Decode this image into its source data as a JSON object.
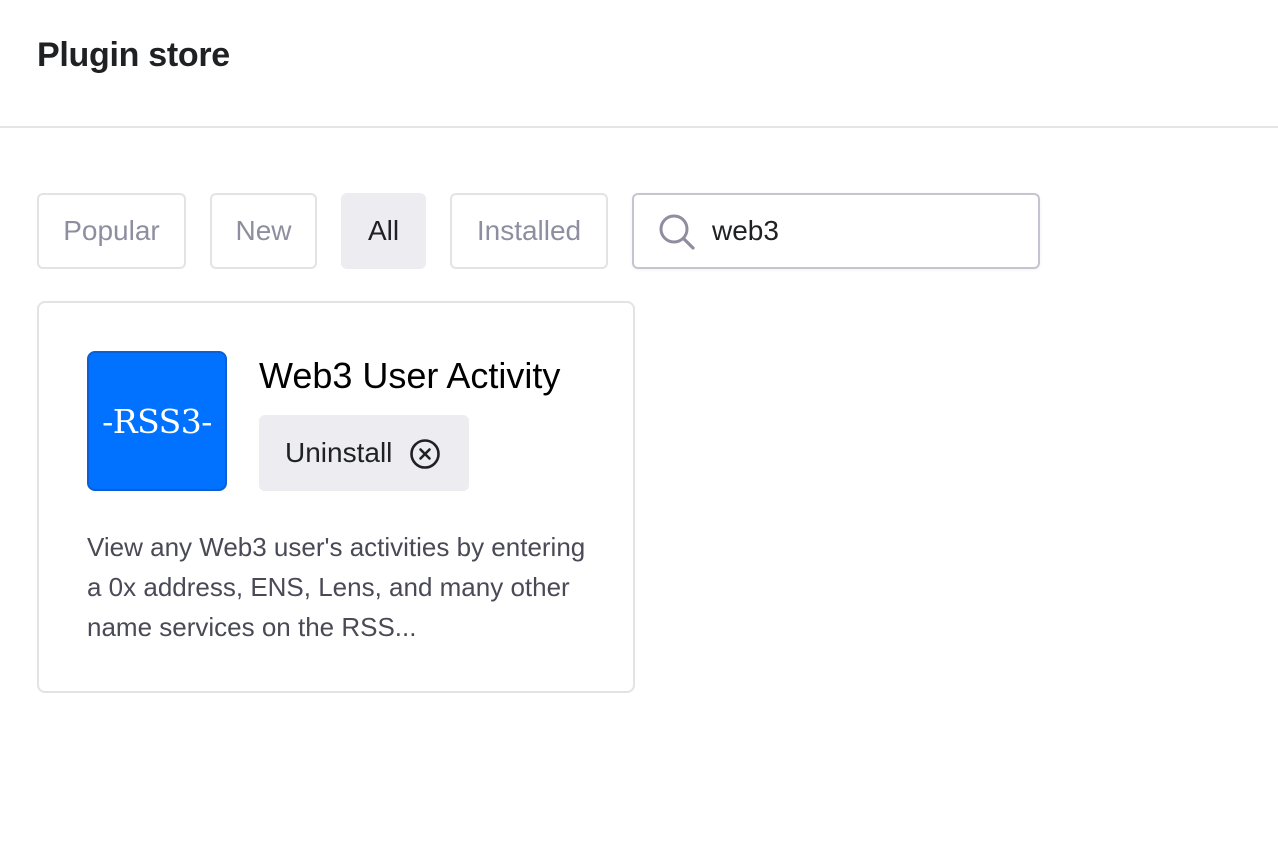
{
  "header": {
    "title": "Plugin store"
  },
  "filters": [
    {
      "label": "Popular",
      "active": false
    },
    {
      "label": "New",
      "active": false
    },
    {
      "label": "All",
      "active": true
    },
    {
      "label": "Installed",
      "active": false
    }
  ],
  "search": {
    "value": "web3",
    "icon": "search-icon"
  },
  "plugins": [
    {
      "name": "Web3 User Activity",
      "logo_text": "-RSS3-",
      "logo_color": "#0072ff",
      "action_label": "Uninstall",
      "action_icon": "close-circle-icon",
      "description": "View any Web3 user's activities by entering a 0x address, ENS, Lens, and many other name services on the RSS..."
    }
  ],
  "colors": {
    "active_filter_bg": "#ececf1",
    "border": "#e3e3e6",
    "muted_text": "#8e8ea0"
  }
}
